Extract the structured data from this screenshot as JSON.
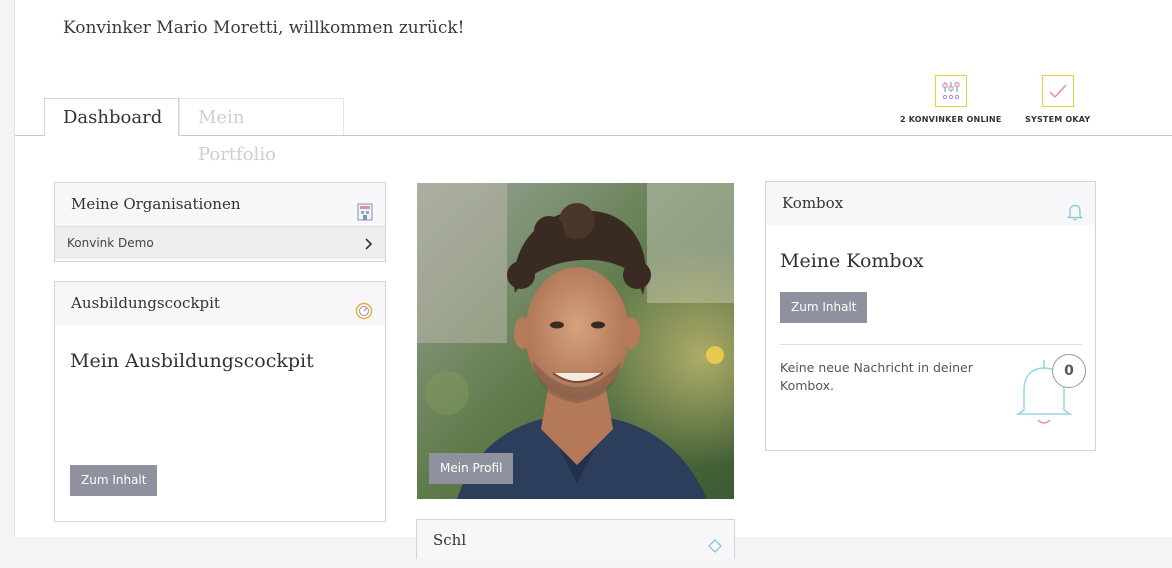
{
  "header": {
    "welcome": "Konvinker Mario Moretti, willkommen zurück!"
  },
  "tabs": [
    {
      "label": "Dashboard",
      "active": true
    },
    {
      "label": "Mein Portfolio",
      "active": false
    }
  ],
  "status": {
    "online_label": "2 KONVINKER ONLINE",
    "online_icon": "sliders-icon",
    "system_label": "SYSTEM OKAY",
    "system_icon": "checkmark-icon",
    "accent_color": "#e9cf3a"
  },
  "organisations": {
    "title": "Meine Organisationen",
    "icon": "building-icon",
    "items": [
      {
        "label": "Konvink Demo"
      }
    ]
  },
  "cockpit": {
    "title": "Ausbildungscockpit",
    "icon": "gauge-icon",
    "heading": "Mein Ausbildungscockpit",
    "button": "Zum Inhalt"
  },
  "profile": {
    "button": "Mein Profil"
  },
  "kombox": {
    "title": "Kombox",
    "icon": "bell-icon",
    "heading": "Meine Kombox",
    "button": "Zum Inhalt",
    "message": "Keine neue Nachricht in deiner Kombox.",
    "count": "0"
  },
  "partial_card": {
    "title": "Schl"
  },
  "colors": {
    "button_bg": "#8f929e",
    "bell_color": "#7fc3d8"
  }
}
